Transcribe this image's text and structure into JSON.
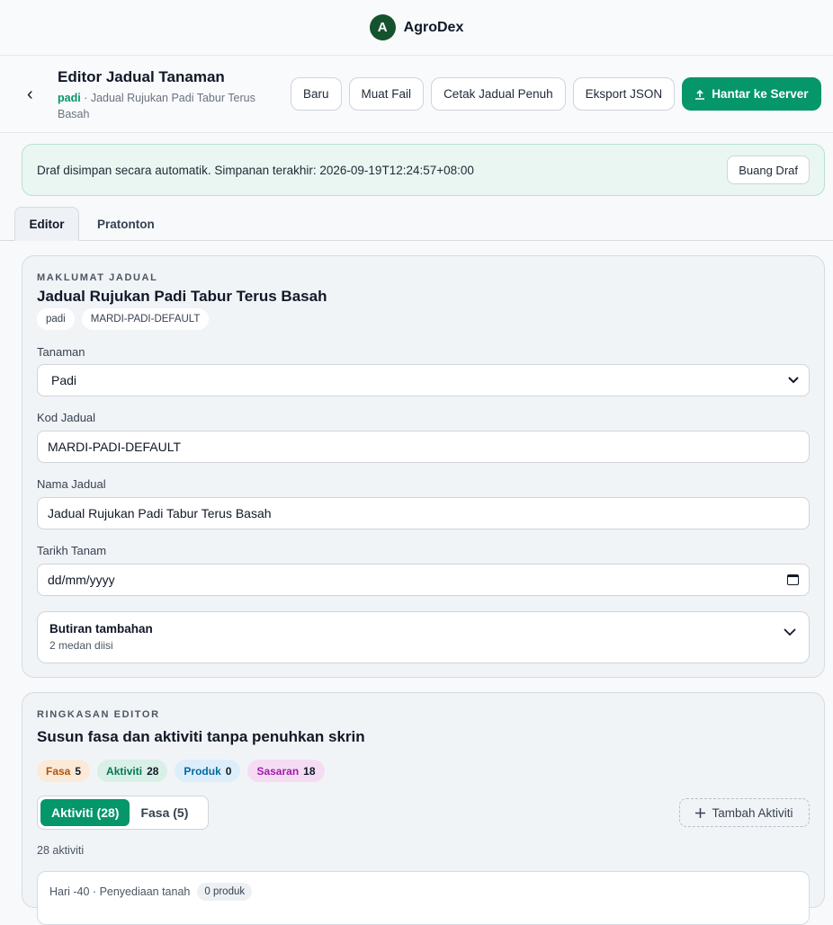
{
  "brand": {
    "name": "AgroDex",
    "logo_letter": "A"
  },
  "header": {
    "title": "Editor Jadual Tanaman",
    "crop": "padi",
    "subtitle": "· Jadual Rujukan Padi Tabur Terus Basah",
    "back_icon": "‹",
    "actions": {
      "new": "Baru",
      "load": "Muat Fail",
      "print": "Cetak Jadual Penuh",
      "export": "Eksport JSON",
      "submit": "Hantar ke Server"
    }
  },
  "draft": {
    "message": "Draf disimpan secara automatik. Simpanan terakhir: 2026-09-19T12:24:57+08:00",
    "discard": "Buang Draf"
  },
  "tabs": {
    "editor": "Editor",
    "preview": "Pratonton"
  },
  "schedule_info": {
    "eyebrow": "MAKLUMAT JADUAL",
    "title": "Jadual Rujukan Padi Tabur Terus Basah",
    "chips": [
      "padi",
      "MARDI-PADI-DEFAULT"
    ],
    "crop_label": "Tanaman",
    "crop_value": "Padi",
    "code_label": "Kod Jadual",
    "code_value": "MARDI-PADI-DEFAULT",
    "name_label": "Nama Jadual",
    "name_value": "Jadual Rujukan Padi Tabur Terus Basah",
    "date_label": "Tarikh Tanam",
    "date_placeholder": "dd/mm/yyyy",
    "details_title": "Butiran tambahan",
    "details_sub": "2 medan diisi"
  },
  "summary": {
    "eyebrow": "RINGKASAN EDITOR",
    "title": "Susun fasa dan aktiviti tanpa penuhkan skrin",
    "stats": {
      "fasa_label": "Fasa",
      "fasa_n": "5",
      "akt_label": "Aktiviti",
      "akt_n": "28",
      "prod_label": "Produk",
      "prod_n": "0",
      "sas_label": "Sasaran",
      "sas_n": "18"
    },
    "seg_activities": "Aktiviti (28)",
    "seg_phases": "Fasa (5)",
    "add_activity": "Tambah Aktiviti",
    "count_text": "28 aktiviti",
    "first_activity": {
      "line": "Hari -40 · Penyediaan tanah",
      "products": "0 produk"
    }
  }
}
